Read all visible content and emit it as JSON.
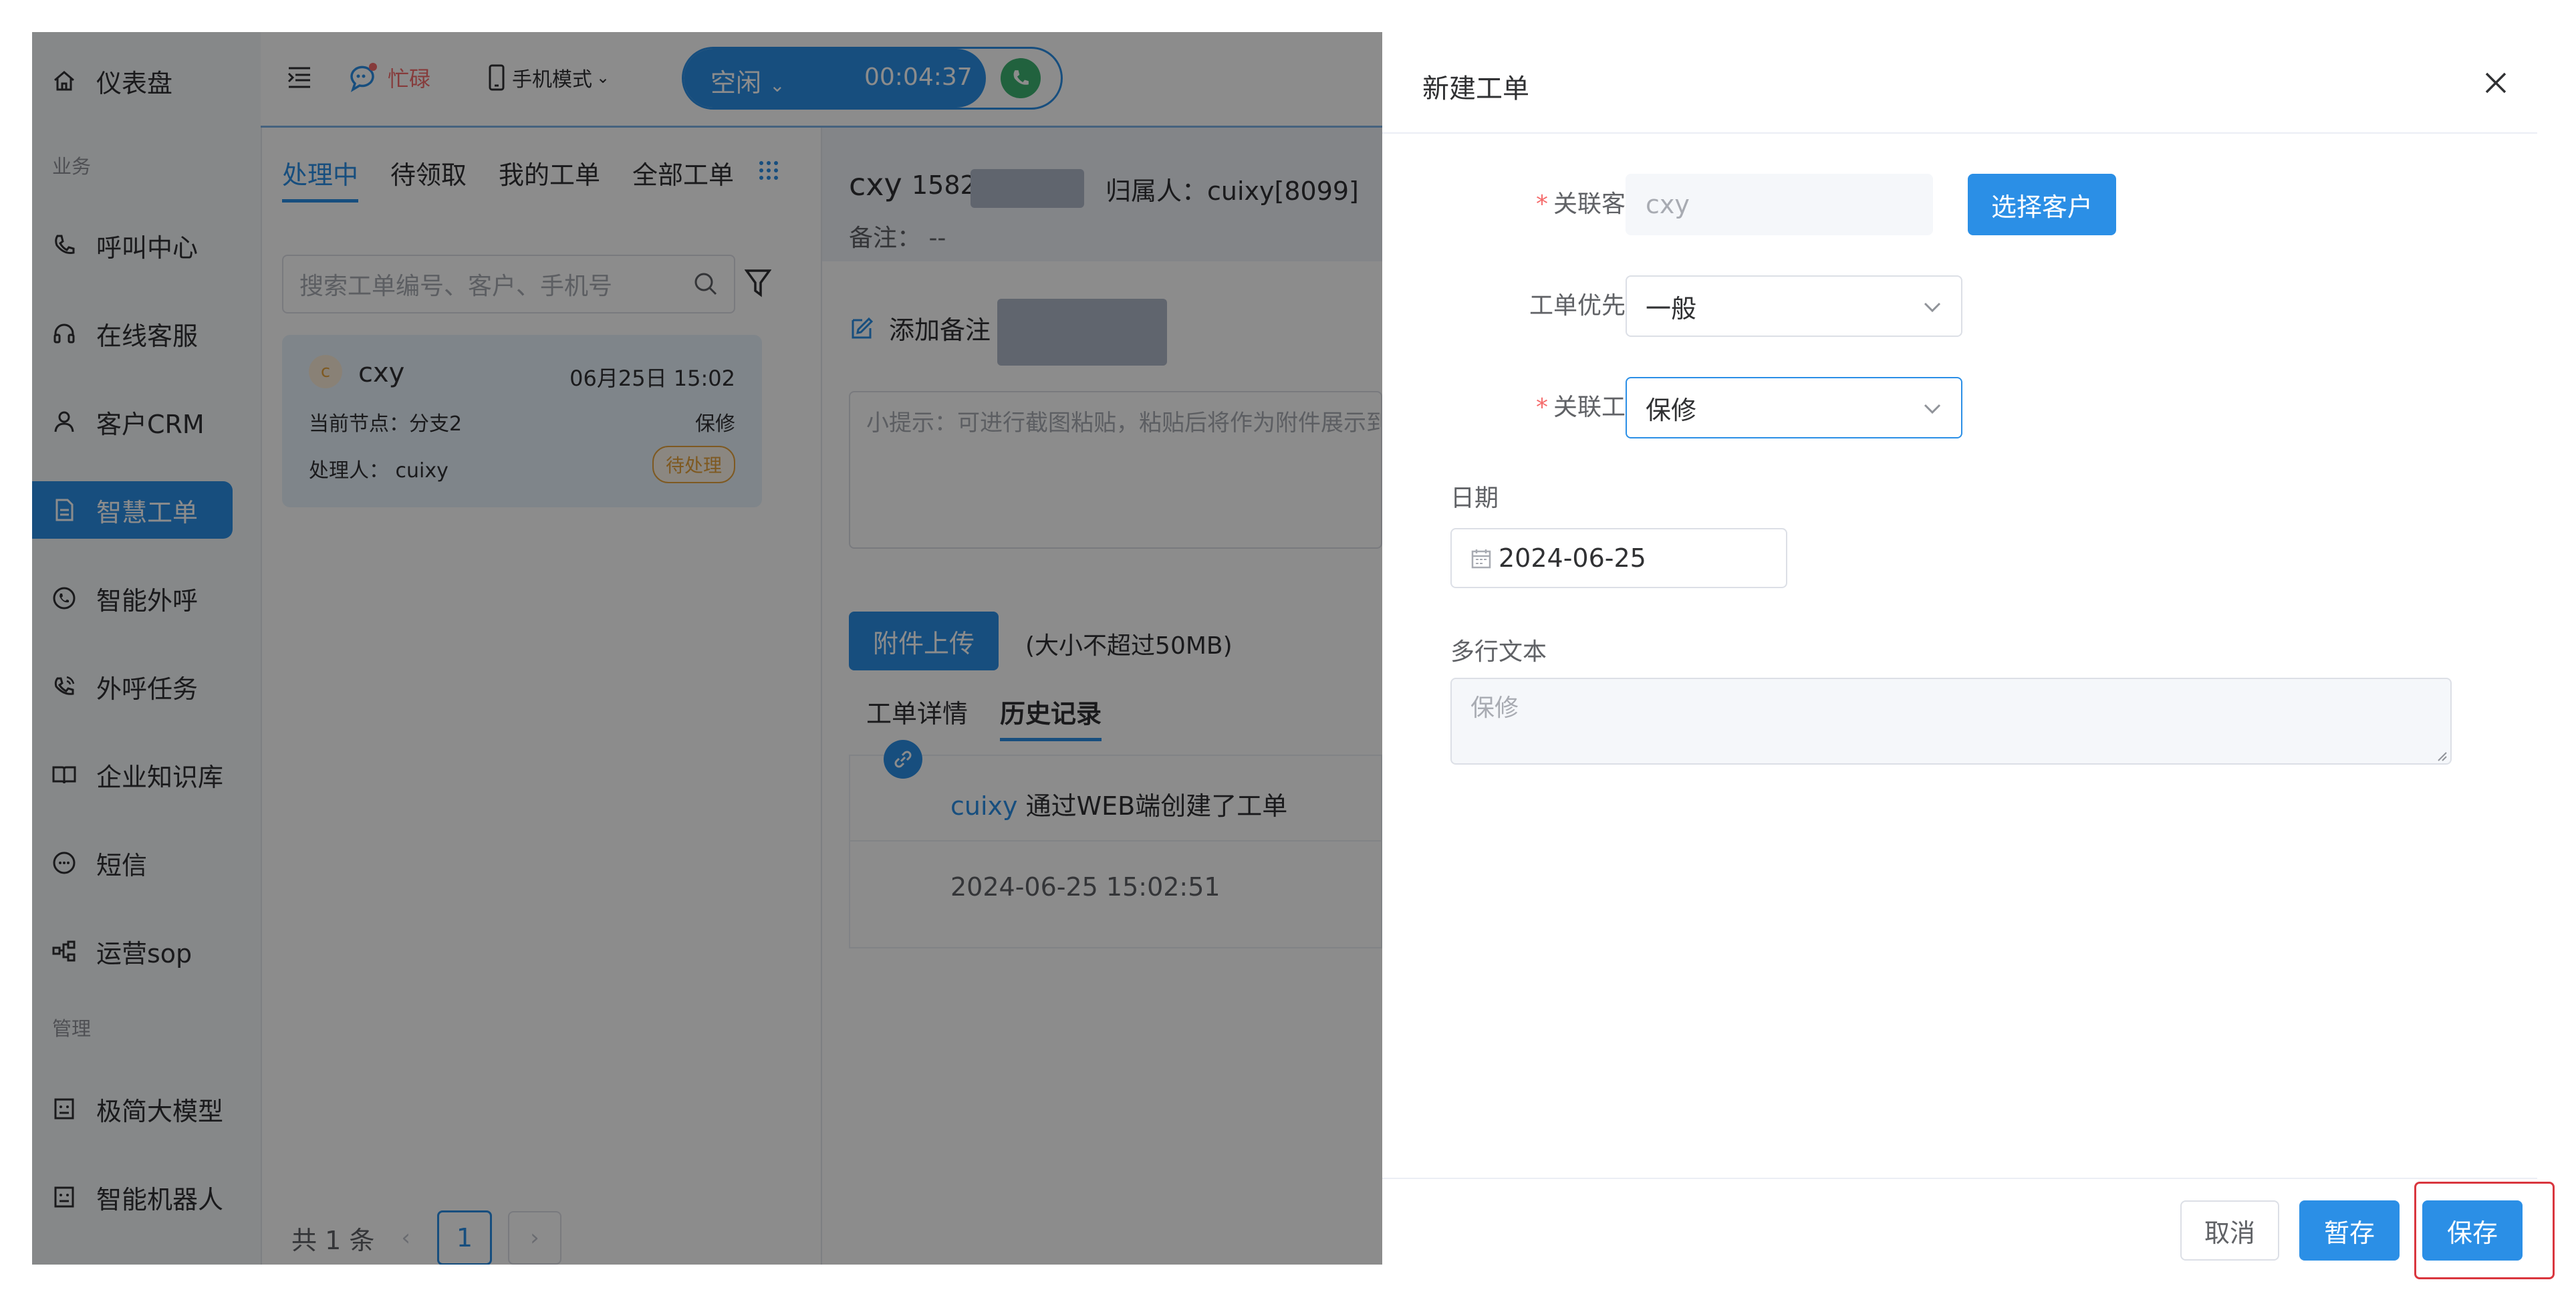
{
  "sidebar": {
    "items": [
      {
        "label": "仪表盘",
        "icon": "home-icon"
      },
      {
        "label": "呼叫中心",
        "icon": "phone-icon"
      },
      {
        "label": "在线客服",
        "icon": "headset-icon"
      },
      {
        "label": "客户CRM",
        "icon": "user-icon"
      },
      {
        "label": "智慧工单",
        "icon": "document-icon"
      },
      {
        "label": "智能外呼",
        "icon": "whatsapp-phone-icon"
      },
      {
        "label": "外呼任务",
        "icon": "outgoing-call-icon"
      },
      {
        "label": "企业知识库",
        "icon": "book-icon"
      },
      {
        "label": "短信",
        "icon": "sms-icon"
      },
      {
        "label": "运营sop",
        "icon": "flow-icon"
      },
      {
        "label": "极简大模型",
        "icon": "robot-icon"
      },
      {
        "label": "智能机器人",
        "icon": "bot-icon"
      }
    ],
    "group_business": "业务",
    "group_manage": "管理",
    "active_color": "#2b8fe6"
  },
  "topbar": {
    "status_busy": "忙碌",
    "phone_mode": "手机模式",
    "agent_state": "空闲",
    "timer": "00:04:37"
  },
  "list": {
    "tabs": [
      "处理中",
      "待领取",
      "我的工单",
      "全部工单"
    ],
    "search_placeholder": "搜索工单编号、客户、手机号",
    "card": {
      "avatar": "c",
      "name": "cxy",
      "time": "06月25日 15:02",
      "node": "当前节点：分支2",
      "type": "保修",
      "handler": "处理人： cuixy",
      "status": "待处理"
    },
    "pagination": {
      "total": "共 1 条",
      "page": "1"
    }
  },
  "detail": {
    "customer": "cxy",
    "phone": "1582",
    "owner": "归属人：cuixy[8099]",
    "remark": "备注： --",
    "add_note": "添加备注",
    "hint": "小提示：可进行截图粘贴，粘贴后将作为附件展示到",
    "upload": "附件上传",
    "upload_limit": "(大小不超过50MB)",
    "tabs": [
      "工单详情",
      "历史记录"
    ],
    "history_user": "cuixy",
    "history_action": " 通过WEB端创建了工单",
    "history_time": "2024-06-25 15:02:51"
  },
  "drawer": {
    "title": "新建工单",
    "customer_label": "关联客户",
    "customer_value": "cxy",
    "select_customer": "选择客户",
    "priority_label": "工单优先级",
    "priority_value": "一般",
    "ticket_label": "关联工单",
    "ticket_value": "保修",
    "date_label": "日期",
    "date_value": "2024-06-25",
    "text_label": "多行文本",
    "text_placeholder": "保修",
    "cancel": "取消",
    "draft": "暂存",
    "save": "保存"
  }
}
